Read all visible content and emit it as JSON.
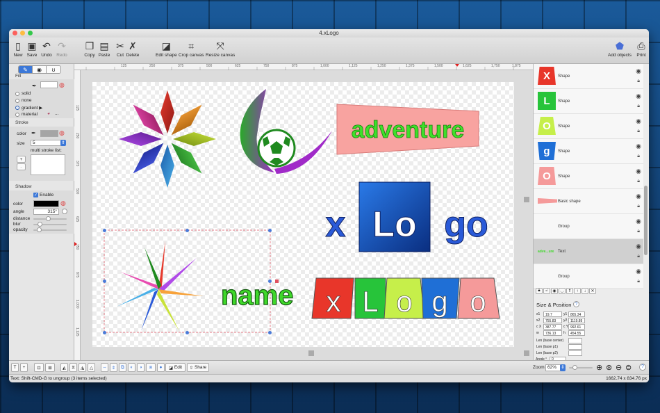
{
  "window": {
    "title": "4.xLogo"
  },
  "toolbar": {
    "new": "New",
    "save": "Save",
    "undo": "Undo",
    "redo": "Redo",
    "copy": "Copy",
    "paste": "Paste",
    "cut": "Cut",
    "delete": "Delete",
    "edit_shape": "Edit shape",
    "crop_canvas": "Crop canvas",
    "resize_canvas": "Resize canvas",
    "add_objects": "Add objects",
    "print": "Print"
  },
  "fill": {
    "title": "Fill",
    "options": [
      "solid",
      "none",
      "gradient ▶",
      "material"
    ],
    "selected": "gradient ▶",
    "material_dots": "..."
  },
  "stroke": {
    "title": "Stroke",
    "color_label": "color",
    "size_label": "size",
    "size_value": "5",
    "multi_label": "multi stroke list:",
    "add": "+",
    "remove": "-"
  },
  "shadow": {
    "title": "Shadow",
    "enable_label": "Enable",
    "color_label": "color",
    "angle_label": "angle",
    "angle_value": "315°",
    "distance_label": "distance",
    "blur_label": "blur",
    "opacity_label": "opacity",
    "color_value": "#000000",
    "distance": 0.45,
    "blur": 0.15,
    "opacity": 0.12
  },
  "ruler": {
    "top": [
      "125",
      "250",
      "375",
      "500",
      "625",
      "750",
      "875",
      "1,000",
      "1,125",
      "1,250",
      "1,375",
      "1,500",
      "1,625",
      "1,750",
      "1,875"
    ],
    "left": [
      "125",
      "250",
      "375",
      "500",
      "625",
      "750",
      "875",
      "1,000",
      "1,125"
    ]
  },
  "canvas": {
    "adventure": "adventure",
    "xlogo_x": "x",
    "xlogo_lo": "Lo",
    "xlogo_go": "go",
    "tiles": [
      "x",
      "L",
      "o",
      "g",
      "o"
    ],
    "tile_colors": [
      "#e8362a",
      "#27c43a",
      "#c6ef4a",
      "#1f6fd6",
      "#f59a9a"
    ],
    "name": "name"
  },
  "layers": [
    {
      "thumb": "X",
      "label": "Shape",
      "color": "#e8362a"
    },
    {
      "thumb": "L",
      "label": "Shape",
      "color": "#27c43a"
    },
    {
      "thumb": "O",
      "label": "Shape",
      "color": "#c6ef4a"
    },
    {
      "thumb": "g",
      "label": "Shape",
      "color": "#1f6fd6"
    },
    {
      "thumb": "O",
      "label": "Shape",
      "color": "#f59a9a"
    },
    {
      "thumb": "",
      "label": "Basic shape",
      "color": "#f59a9a"
    },
    {
      "thumb": "",
      "label": "Group",
      "color": ""
    },
    {
      "thumb": "adve...ure",
      "label": "Text",
      "color": "#27c43a"
    },
    {
      "thumb": "",
      "label": "Group",
      "color": ""
    }
  ],
  "size_position": {
    "title": "Size & Position",
    "help": "?",
    "x1_label": "x1",
    "x1": "19.7",
    "y1_label": "y1",
    "y1": "865.34",
    "x2_label": "x2",
    "x2": "755.83",
    "y2_label": "y2",
    "y2": "1119.89",
    "cx_label": "c X",
    "cx": "387.77",
    "cy_label": "c Y",
    "cy": "992.61",
    "w_label": "w",
    "w": "736.13",
    "h_label": "h",
    "h": "454.55",
    "len_center": "Len (base center)",
    "len_p1": "Len (base p1)",
    "len_p2": "Len (base p2)",
    "angle_label": "Angle °",
    "angle": "0"
  },
  "bottom": {
    "edit": "Edit",
    "share": "Share",
    "zoom_label": "Zoom",
    "zoom_value": "62%",
    "help": "?"
  },
  "status": {
    "left": "Text: Shift-CMD-G to ungroup (3 items selected)",
    "right": "1662.74 x 834.76 px"
  }
}
